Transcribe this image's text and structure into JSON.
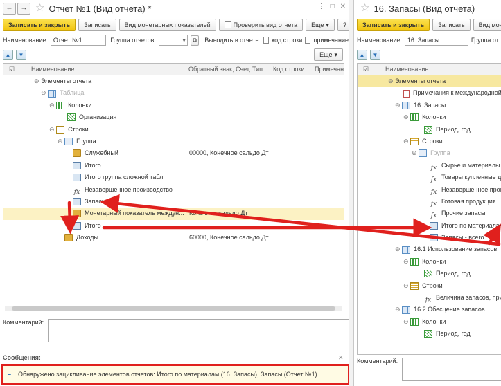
{
  "left": {
    "title": "Отчет №1 (Вид отчета) *",
    "toolbar": {
      "save_close": "Записать и закрыть",
      "save": "Записать",
      "monetary": "Вид монетарных показателей",
      "check": "Проверить вид отчета",
      "more": "Еще",
      "help": "?"
    },
    "form": {
      "name_label": "Наименование:",
      "name_value": "Отчет №1",
      "group_label": "Группа отчетов:",
      "output_label": "Выводить в отчете:",
      "code_label": "код строки",
      "note_label": "примечание"
    },
    "more2": "Еще",
    "columns": [
      "Наименование",
      "Обратный знак, Счет, Тип ...",
      "Код строки",
      "Примечани"
    ],
    "rows": [
      {
        "label": "Элементы отчета",
        "value": ""
      },
      {
        "label": "Таблица",
        "value": ""
      },
      {
        "label": "Колонки",
        "value": ""
      },
      {
        "label": "Организация",
        "value": ""
      },
      {
        "label": "Строки",
        "value": ""
      },
      {
        "label": "Группа",
        "value": ""
      },
      {
        "label": "Служебный",
        "value": "00000, Конечное сальдо Дт"
      },
      {
        "label": "Итого",
        "value": ""
      },
      {
        "label": "Итого группа сложной табл",
        "value": ""
      },
      {
        "label": "Незавершенное производство",
        "value": ""
      },
      {
        "label": "Запасы",
        "value": ""
      },
      {
        "label": "Монетарный показатель междун...",
        "value": "Конечное сальдо Дт"
      },
      {
        "label": "Итого",
        "value": ""
      },
      {
        "label": "Доходы",
        "value": "60000, Конечное сальдо Дт"
      }
    ],
    "comment_label": "Комментарий:",
    "messages_label": "Сообщения:",
    "message": "Обнаружено зацикливание элементов отчетов: Итого по материалам (16. Запасы), Запасы (Отчет №1)"
  },
  "right": {
    "title": "16. Запасы (Вид отчета)",
    "toolbar": {
      "save_close": "Записать и закрыть",
      "save": "Записать",
      "monetary": "Вид мон"
    },
    "form": {
      "name_label": "Наименование:",
      "name_value": "16. Запасы",
      "group_label": "Группа от"
    },
    "columns": [
      "Наименование"
    ],
    "rows": [
      {
        "label": "Элементы отчета"
      },
      {
        "label": "Примечания к международной ф"
      },
      {
        "label": "16. Запасы"
      },
      {
        "label": "Колонки"
      },
      {
        "label": "Период, год"
      },
      {
        "label": "Строки"
      },
      {
        "label": "Группа"
      },
      {
        "label": "Сырье и материалы"
      },
      {
        "label": "Товары купленные для"
      },
      {
        "label": "Незавершенное произв"
      },
      {
        "label": "Готовая продукция"
      },
      {
        "label": "Прочие запасы"
      },
      {
        "label": "Итого по материалам"
      },
      {
        "label": "Запасы - всего"
      },
      {
        "label": "16.1 Использование запасов"
      },
      {
        "label": "Колонки"
      },
      {
        "label": "Период, год"
      },
      {
        "label": "Строки"
      },
      {
        "label": "Величина запасов, призна"
      },
      {
        "label": "16.2 Обесцение запасов"
      },
      {
        "label": "Колонки"
      },
      {
        "label": "Период, год"
      }
    ],
    "comment_label": "Комментарий:"
  },
  "colors": {
    "accent_yellow": "#f1c40f",
    "arrow_red": "#e0201d",
    "selected_row": "#f7e8a0"
  }
}
